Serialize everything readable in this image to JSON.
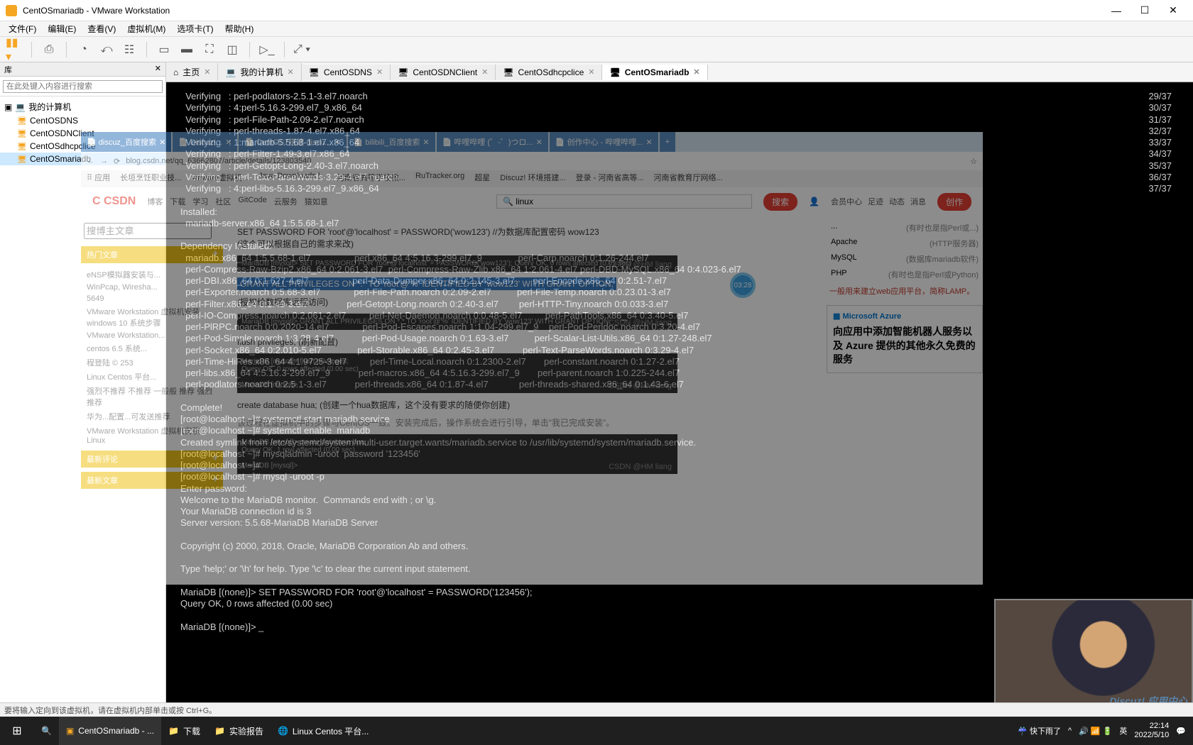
{
  "window": {
    "title": "CentOSmariadb - VMware Workstation"
  },
  "menu": {
    "file": "文件(F)",
    "edit": "编辑(E)",
    "view": "查看(V)",
    "vm": "虚拟机(M)",
    "tabs": "选项卡(T)",
    "help": "帮助(H)"
  },
  "library": {
    "title": "库",
    "search_ph": "在此处键入内容进行搜索",
    "root": "我的计算机",
    "vms": [
      "CentOSDNS",
      "CentOSDNClient",
      "CentOSdhcpclice",
      "CentOSmariadb"
    ]
  },
  "tabs": [
    {
      "label": "主页",
      "icon": "home"
    },
    {
      "label": "我的计算机",
      "icon": "pc"
    },
    {
      "label": "CentOSDNS",
      "icon": "vm"
    },
    {
      "label": "CentOSDNClient",
      "icon": "vm"
    },
    {
      "label": "CentOSdhcpclice",
      "icon": "vm"
    },
    {
      "label": "CentOSmariadb",
      "icon": "vm",
      "active": true
    }
  ],
  "term": {
    "verify": [
      {
        "l": "  Verifying   : perl-podlators-2.5.1-3.el7.noarch",
        "r": "29/37"
      },
      {
        "l": "  Verifying   : 4:perl-5.16.3-299.el7_9.x86_64",
        "r": "30/37"
      },
      {
        "l": "  Verifying   : perl-File-Path-2.09-2.el7.noarch",
        "r": "31/37"
      },
      {
        "l": "  Verifying   : perl-threads-1.87-4.el7.x86_64",
        "r": "32/37"
      },
      {
        "l": "  Verifying   : 1:mariadb-5.5.68-1.el7.x86_64",
        "r": "33/37"
      },
      {
        "l": "  Verifying   : perl-Filter-1.49-3.el7.x86_64",
        "r": "34/37"
      },
      {
        "l": "  Verifying   : perl-Getopt-Long-2.40-3.el7.noarch",
        "r": "35/37"
      },
      {
        "l": "  Verifying   : perl-Text-ParseWords-3.29-4.el7.noarch",
        "r": "36/37"
      },
      {
        "l": "  Verifying   : 4:perl-libs-5.16.3-299.el7_9.x86_64",
        "r": "37/37"
      }
    ],
    "installed_hdr": "Installed:",
    "installed": "  mariadb-server.x86_64 1:5.5.68-1.el7",
    "dep_hdr": "Dependency Installed:",
    "deps": "  mariadb.x86_64 1:5.5.68-1.el7                 perl.x86_64 4:5.16.3-299.el7_9              perl-Carp.noarch 0:1.26-244.el7\n  perl-Compress-Raw-Bzip2.x86_64 0:2.061-3.el7  perl-Compress-Raw-Zlib.x86_64 1:2.061-4.el7 perl-DBD-MySQL.x86_64 0:4.023-6.el7\n  perl-DBI.x86_64 0:1.627-4.el7                 perl-Data-Dumper.x86_64 0:2.145-3.el7       perl-Encode.x86_64 0:2.51-7.el7\n  perl-Exporter.noarch 0:5.68-3.el7             perl-File-Path.noarch 0:2.09-2.el7          perl-File-Temp.noarch 0:0.23.01-3.el7\n  perl-Filter.x86_64 0:1.49-3.el7               perl-Getopt-Long.noarch 0:2.40-3.el7        perl-HTTP-Tiny.noarch 0:0.033-3.el7\n  perl-IO-Compress.noarch 0:2.061-2.el7         perl-Net-Daemon.noarch 0:0.48-5.el7         perl-PathTools.x86_64 0:3.40-5.el7\n  perl-PlRPC.noarch 0:0.2020-14.el7             perl-Pod-Escapes.noarch 1:1.04-299.el7_9    perl-Pod-Perldoc.noarch 0:3.20-4.el7\n  perl-Pod-Simple.noarch 1:3.28-4.el7           perl-Pod-Usage.noarch 0:1.63-3.el7          perl-Scalar-List-Utils.x86_64 0:1.27-248.el7\n  perl-Socket.x86_64 0:2.010-5.el7              perl-Storable.x86_64 0:2.45-3.el7           perl-Text-ParseWords.noarch 0:3.29-4.el7\n  perl-Time-HiRes.x86_64 4:1.9725-3.el7         perl-Time-Local.noarch 0:1.2300-2.el7       perl-constant.noarch 0:1.27-2.el7\n  perl-libs.x86_64 4:5.16.3-299.el7_9           perl-macros.x86_64 4:5.16.3-299.el7_9       perl-parent.noarch 1:0.225-244.el7\n  perl-podlators.noarch 0:2.5.1-3.el7           perl-threads.x86_64 0:1.87-4.el7            perl-threads-shared.x86_64 0:1.43-6.el7",
    "complete": "Complete!",
    "shell": "[root@localhost ~]# systemctl start mariadb.service\n[root@localhost ~]# systemctl enable  mariadb\nCreated symlink from /etc/systemd/system/multi-user.target.wants/mariadb.service to /usr/lib/systemd/system/mariadb.service.\n[root@localhost ~]# mysqladmin -uroot  password '123456'\n[root@localhost ~]# \n[root@localhost ~]# mysql -uroot -p\nEnter password: \nWelcome to the MariaDB monitor.  Commands end with ; or \\g.\nYour MariaDB connection id is 3\nServer version: 5.5.68-MariaDB MariaDB Server\n\nCopyright (c) 2000, 2018, Oracle, MariaDB Corporation Ab and others.\n\nType 'help;' or '\\h' for help. Type '\\c' to clear the current input statement.\n\nMariaDB [(none)]> SET PASSWORD FOR 'root'@'localhost' = PASSWORD('123456');\nQuery OK, 0 rows affected (0.00 sec)\n\nMariaDB [(none)]> _"
  },
  "overlay": {
    "btabs": [
      "discuz_百度搜索",
      "Discuz!...",
      "CentOS7搭建 discu...",
      "bilibili_百度搜索",
      "哔哩哔哩 (゜-゜)つロ...",
      "创作中心 - 哔哩哔哩..."
    ],
    "url": "blog.csdn.net/qq_63662807/article/details/123803540",
    "bookmarks": [
      "应用",
      "长垣烹饪职业技...",
      "vmware虚拟机...",
      "Java Downloads |...",
      "河南省高等学校教...",
      "RuTracker.org",
      "超星",
      "Discuz! 环境搭建...",
      "登录 - 河南省高等...",
      "河南省教育厅网络..."
    ],
    "csdn_nav": [
      "博客",
      "下载",
      "学习",
      "社区",
      "GitCode",
      "云服务",
      "猿如意"
    ],
    "search_term": "linux",
    "search_btn": "搜索",
    "links": [
      "会员中心",
      "足迹",
      "动态",
      "消息"
    ],
    "create_btn": "创作",
    "search_blog_ph": "搜博主文章",
    "left_sections": [
      "热门文章",
      "最新评论",
      "最新文章"
    ],
    "left_items": [
      "eNSP模拟器安装与...",
      "WinPcap, Wiresha...",
      "5649",
      "VMware Workstation 虚拟机安装windows 10 系统步骤",
      "VMware Workstation...",
      "centos 6.5 系统...",
      "程登陆 © 253",
      "Linux Centos 平台...",
      "强烈不推荐 不推荐 一般般 推荐 强烈推荐",
      "华为...配置...可发送推荐",
      "VMware Workstation 虚拟机安装Linux"
    ],
    "setpass_note": "SET PASSWORD FOR 'root'@'localhost' = PASSWORD('wow123')  //为数据库配置密码 wow123\n(这个可以根据自己的需求来改)",
    "grant_sql": "GRANT ALL PRIVILEGES ON *.* TO 'root'@'%' IDENTIFIED BY 'wow123' WITH GRANT OPTION;",
    "grant_note": "(授权给数据库远程访问)",
    "flush": "flush privileges;      (刷新配置)",
    "createdb": "create database hua;     (创建一个hua数据库，这个没有要求的随便你创建)",
    "install_note": "该过程在虚拟机中的步骤与CentOS一致。安装完成后，操作系统会进行引导，单击\"我已完成安装\"。",
    "wm": "CSDN @HM liang",
    "code1": "MariaDB [mysql]> SET PASSWORD FOR 'root'@'localhost' = PASSWORD('wow123');\nQuery OK, 0 rows affected (0.01 sec)",
    "code2": "MariaDB [mysql]> GRANT ALL PRIVILEGES ON *.* TO 'root'@'%' IDENTIFIED BY 'wow123' WITH GRANT OPTION;",
    "code3": "MariaDB [mysql]> flush privileges;\nQuery OK, 0 rows affected (0.00 sec)\n\nMariaDB [mysql]> ",
    "code4": "MariaDB [mysql]> create database hua;\nQuery OK, 1 row affected (0.00 sec)\n\nMariaDB [mysql]> ",
    "right_items": [
      {
        "k": "...",
        "v": "(有时也是指Perl或...)"
      },
      {
        "k": "Apache",
        "v": "(HTTP服务器)"
      },
      {
        "k": "MySQL",
        "v": "(数据库mariadb软件)"
      },
      {
        "k": "PHP",
        "v": "(有时也是指Perl或Python)"
      }
    ],
    "right_note": "一般用来建立web应用平台，简称LAMP。",
    "azure_h": "Microsoft Azure",
    "azure_t": "向应用中添加智能机器人服务以及 Azure 提供的其他永久免费的服务"
  },
  "badge": "03:28",
  "webcam_wm": "Discuz! 应用中心",
  "status": "要将输入定向到该虚拟机，请在虚拟机内部单击或按 Ctrl+G。",
  "taskbar": {
    "items": [
      {
        "label": "CentOSmariadb - ...",
        "icon": "vmware"
      },
      {
        "label": "下载",
        "icon": "folder"
      },
      {
        "label": "实验报告",
        "icon": "folder"
      },
      {
        "label": "Linux Centos 平台...",
        "icon": "chrome"
      }
    ],
    "weather": "快下雨了",
    "time": "22:14",
    "date": "2022/5/10"
  }
}
